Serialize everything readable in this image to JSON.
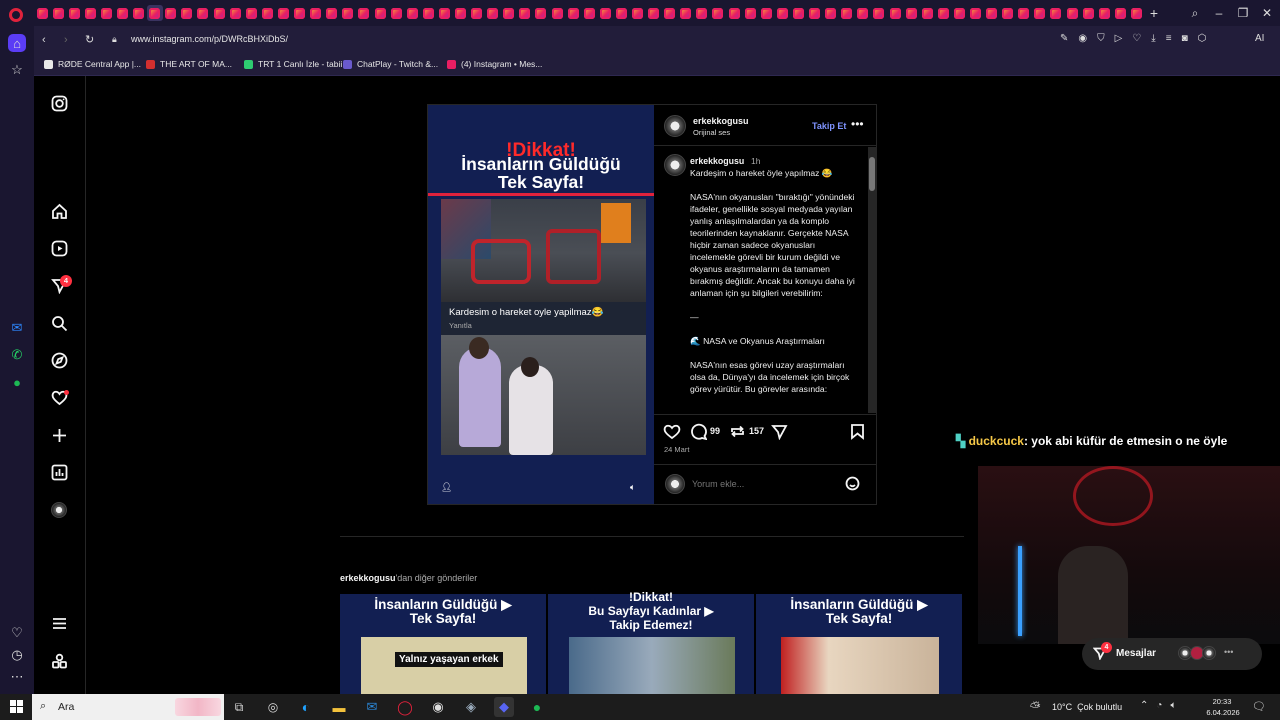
{
  "browser": {
    "url": "www.instagram.com/p/DWRcBHXiDbS/",
    "bookmarks": [
      {
        "label": "RØDE Central App |...",
        "color": "#e8e8e8"
      },
      {
        "label": "THE ART OF MA...",
        "color": "#d32f2f"
      },
      {
        "label": "TRT 1 Canlı İzle - tabii",
        "color": "#2ecc71"
      },
      {
        "label": "ChatPlay - Twitch &...",
        "color": "#6a5acd"
      },
      {
        "label": "(4) Instagram • Mes...",
        "color": "#e91e63"
      }
    ],
    "ai_label": "AI",
    "sidebar_icons": [
      "home-icon",
      "star-icon",
      "messenger-icon",
      "whatsapp-icon",
      "spotify-icon"
    ]
  },
  "instagram": {
    "nav": {
      "notification_count": "4"
    },
    "post": {
      "author": "erkekkogusu",
      "audio": "Orijinal ses",
      "follow_label": "Takip Et",
      "comment_author": "erkekkogusu",
      "comment_time": "1h",
      "caption": "Kardeşim o hareket öyle yapılmaz 😂\n\nNASA'nın okyanusları \"bıraktığı\" yönündeki ifadeler, genellikle sosyal medyada yayılan yanlış anlaşılmalardan ya da komplo teorilerinden kaynaklanır. Gerçekte NASA hiçbir zaman sadece okyanusları incelemekle görevli bir kurum değildi ve okyanus araştırmalarını da tamamen bırakmış değildir. Ancak bu konuyu daha iyi anlaman için şu bilgileri verebilirim:\n\n—\n\n🌊 NASA ve Okyanus Araştırmaları\n\nNASA'nın esas görevi uzay araştırmaları olsa da, Dünya'yı da incelemek için birçok görev yürütür. Bu görevler arasında:",
      "comments_count": "99",
      "reposts_count": "157",
      "date": "24 Mart",
      "comment_placeholder": "Yorum ekle...",
      "media": {
        "title_line1": "!Dikkat!",
        "title_line2": "İnsanların Güldüğü",
        "title_line3": "Tek Sayfa!",
        "embedded_comment": "Kardesim o hareket oyle yapilmaz😂",
        "embedded_reply": "Yanıtla"
      }
    },
    "more_from": {
      "user": "erkekkogusu",
      "suffix": "'dan diğer gönderiler",
      "items": [
        {
          "line1": "İnsanların Güldüğü",
          "line2": "Tek Sayfa!",
          "caption": "Yalnız yaşayan erkek"
        },
        {
          "line0": "!Dikkat!",
          "line1": "Bu Sayfayı Kadınlar",
          "line2": "Takip Edemez!",
          "caption": ""
        },
        {
          "line1": "İnsanların Güldüğü",
          "line2": "Tek Sayfa!",
          "caption": ""
        }
      ]
    },
    "messages": {
      "label": "Mesajlar",
      "count": "4"
    }
  },
  "stream_overlay": {
    "chat_user": "duckcuck",
    "chat_message": ": yok abi küfür de etmesin o ne öyle"
  },
  "taskbar": {
    "search_label": "Ara",
    "weather": "10°C  Çok bulutlu",
    "time": "20:33",
    "date": "6.04.2026"
  }
}
